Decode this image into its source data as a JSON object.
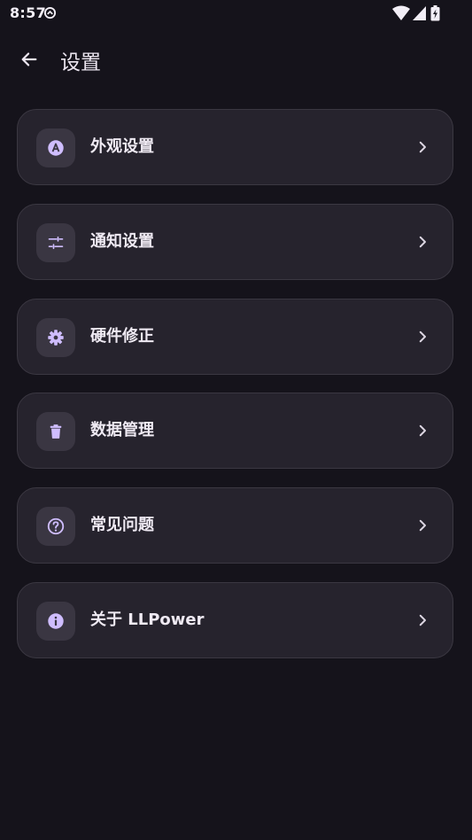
{
  "status_bar": {
    "time": "8:57",
    "icons": [
      "data-saver-icon",
      "wifi-icon",
      "cellular-signal-icon",
      "battery-charging-icon"
    ]
  },
  "app_bar": {
    "back_icon": "arrow-back-icon",
    "title": "设置"
  },
  "settings_items": [
    {
      "label": "外观设置",
      "icon": "palette-icon"
    },
    {
      "label": "通知设置",
      "icon": "tune-icon"
    },
    {
      "label": "硬件修正",
      "icon": "gear-icon"
    },
    {
      "label": "数据管理",
      "icon": "trash-icon"
    },
    {
      "label": "常见问题",
      "icon": "help-circle-icon"
    },
    {
      "label": "关于 LLPower",
      "icon": "info-icon"
    }
  ],
  "colors": {
    "background": "#15131b",
    "card": "#26232d",
    "card_border": "#3b3842",
    "icon_box": "#3a3642",
    "accent": "#cfbdfe",
    "text": "#efeaf3"
  }
}
